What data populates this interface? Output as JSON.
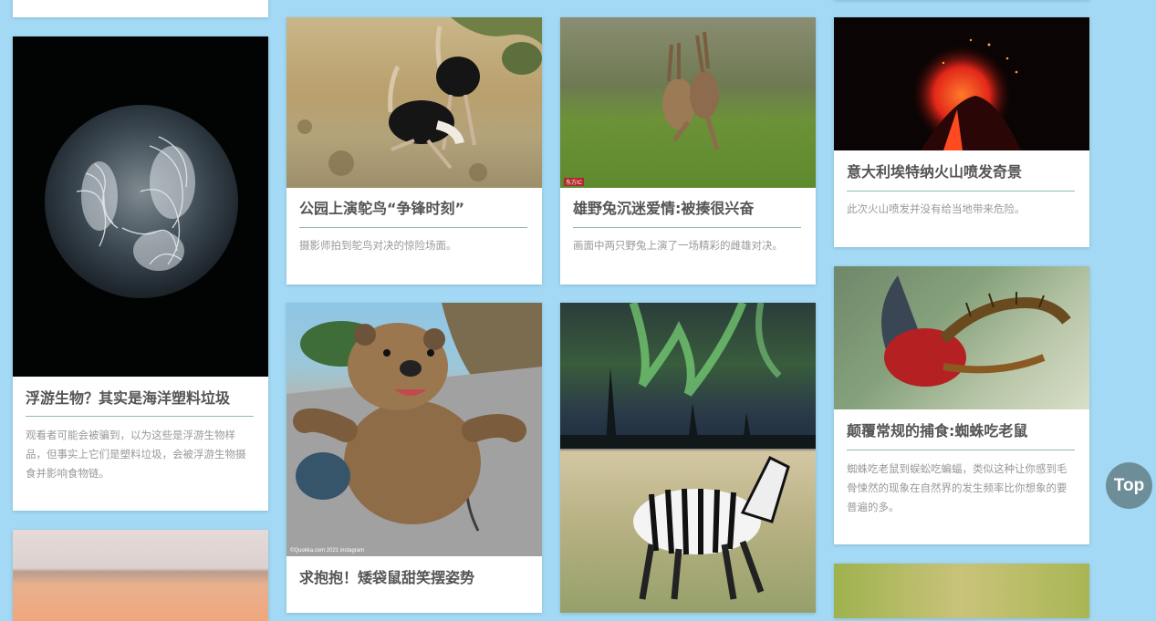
{
  "cards": [
    {
      "title": "浮游生物？其实是海洋塑料垃圾",
      "desc": "观看者可能会被骗到，以为这些是浮游生物样品，但事实上它们是塑料垃圾，会被浮游生物摄食并影响食物链。"
    },
    {
      "title": "公园上演鸵鸟“争锋时刻”",
      "desc": "摄影师拍到鸵鸟对决的惊险场面。"
    },
    {
      "title": "求抱抱！矮袋鼠甜笑摆姿势",
      "watermark": "©Quokka.com 2021 instagram"
    },
    {
      "title": "雄野兔沉迷爱情:被揍很兴奋",
      "desc": "画面中两只野兔上演了一场精彩的雌雄对决。",
      "watermark": "东方IC"
    },
    {
      "title": "意大利埃特纳火山喷发奇景",
      "desc": "此次火山喷发并没有给当地带来危险。"
    },
    {
      "title": "颠覆常规的捕食:蜘蛛吃老鼠",
      "desc": "蜘蛛吃老鼠到蜈蚣吃蝙蝠，类似这种让你感到毛骨悚然的现象在自然界的发生频率比你想象的要普遍的多。"
    }
  ],
  "top_button": {
    "label": "Top"
  }
}
